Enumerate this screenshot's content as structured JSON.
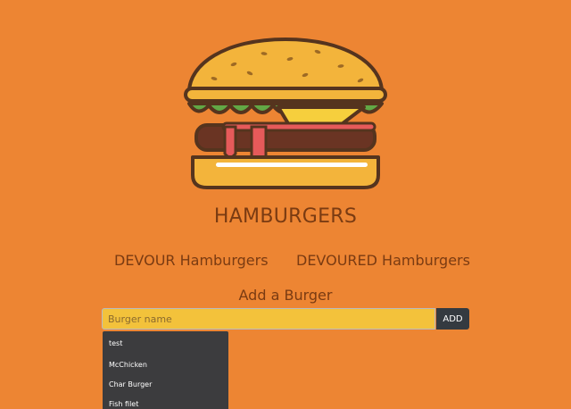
{
  "header": {
    "title": "HAMBURGERS"
  },
  "sections": {
    "devour_heading": "DEVOUR Hamburgers",
    "devoured_heading": "DEVOURED Hamburgers"
  },
  "add_form": {
    "heading": "Add a Burger",
    "input_placeholder": "Burger name",
    "input_value": "",
    "add_button_label": "ADD"
  },
  "autocomplete": {
    "items": [
      "test",
      "McChicken",
      "Char Burger",
      "Fish filet"
    ]
  },
  "colors": {
    "background": "#ed8533",
    "text": "#7a3b12",
    "input_background": "#f3c23b",
    "button_background": "#343a40",
    "dropdown_background": "#3c3c3e"
  },
  "icons": {
    "logo": "hamburger-logo-icon"
  }
}
